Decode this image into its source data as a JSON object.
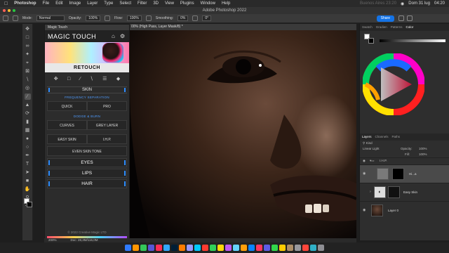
{
  "menubar": {
    "app": "Photoshop",
    "items": [
      "File",
      "Edit",
      "Image",
      "Layer",
      "Type",
      "Select",
      "Filter",
      "3D",
      "View",
      "Plugins",
      "Window",
      "Help"
    ],
    "search": "Buenos Aires 23:20",
    "date": "Dom 31 lug",
    "time": "04:20"
  },
  "window": {
    "title": "Adobe Photoshop 2022"
  },
  "options": {
    "mode_label": "Mode:",
    "mode_value": "Normal",
    "opacity_label": "Opacity:",
    "opacity_value": "100%",
    "flow_label": "Flow:",
    "flow_value": "100%",
    "smoothing_label": "Smoothing:",
    "smoothing_value": "0%",
    "angle_value": "0°",
    "share_label": "Share"
  },
  "magic_touch": {
    "panel_label": "Magic Touch",
    "title": "MAGIC TOUCH",
    "retouch": "RETOUCH",
    "skin": "SKIN",
    "freq_sep": "FREQUENCY SEPARATION",
    "quick": "QUICK",
    "pro": "PRO",
    "dodge_burn": "DODGE & BURN",
    "curves": "CURVES",
    "grey_layer": "GREY LAYER",
    "easy_skin": "EASY SKIN",
    "ihp": "I.H.P.",
    "even_skin_tone": "EVEN SKIN TONE",
    "eyes": "EYES",
    "lips": "LIPS",
    "hair": "HAIR",
    "copyright": "© 2022 Creative Magic LTD"
  },
  "document": {
    "tab": "00% (High Pass, Layer Mask/8) *",
    "zoom": "200%",
    "doc_info": "Doc: 28,3M/116,0M"
  },
  "right_panel": {
    "tabs": [
      "Swatch",
      "Gradien",
      "Patterns",
      "Color"
    ],
    "layer_tabs": [
      "Layers",
      "Channels",
      "Paths"
    ],
    "kind_label": "Kind",
    "blend_mode": "Linear Light",
    "opacity_label": "Opacity:",
    "opacity_value": "100%",
    "fill_label": "Fill:",
    "fill_value": "100%",
    "layers": [
      {
        "name": "I.H.P."
      },
      {
        "name": "Hi...a"
      },
      {
        "name": "Easy Skin"
      },
      {
        "name": "Layer 0"
      }
    ]
  },
  "colors": {
    "accent": "#1473e6",
    "bar": "#2d8cff"
  }
}
